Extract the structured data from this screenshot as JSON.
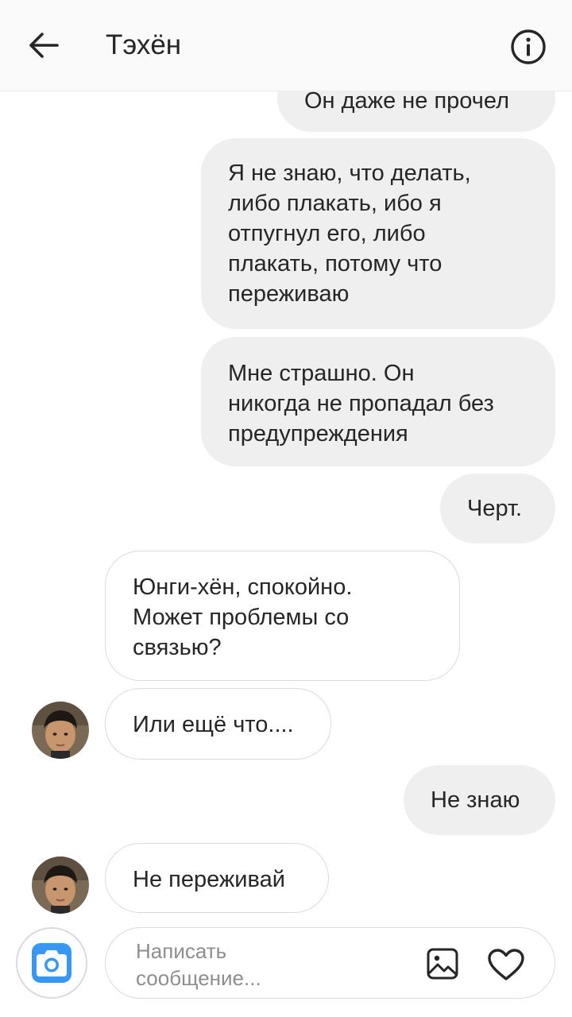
{
  "header": {
    "title": "Тэхён",
    "back_icon": "arrow-left-icon",
    "info_icon": "info-icon"
  },
  "messages": [
    {
      "direction": "out",
      "text": "Он даже не прочел"
    },
    {
      "direction": "out",
      "text": "Я не знаю, что делать,\nлибо плакать, ибо я\nотпугнул его, либо\nплакать, потому что\nпереживаю"
    },
    {
      "direction": "out",
      "text": "Мне страшно. Он\nникогда не пропадал без\nпредупреждения"
    },
    {
      "direction": "out",
      "text": "Черт."
    },
    {
      "direction": "in",
      "text": "Юнги-хён, спокойно.\nМожет проблемы со\nсвязью?"
    },
    {
      "direction": "in",
      "text": "Или ещё что...."
    },
    {
      "direction": "out",
      "text": "Не знаю"
    },
    {
      "direction": "in",
      "text": "Не переживай"
    }
  ],
  "composer": {
    "placeholder": "Написать\nсообщение...",
    "camera_icon": "camera-icon",
    "gallery_icon": "image-icon",
    "like_icon": "heart-icon",
    "accent_color": "#3897f0"
  },
  "colors": {
    "outgoing_bubble": "#efeff0",
    "incoming_border": "#dbdbdb",
    "header_bg": "#fafafa"
  }
}
